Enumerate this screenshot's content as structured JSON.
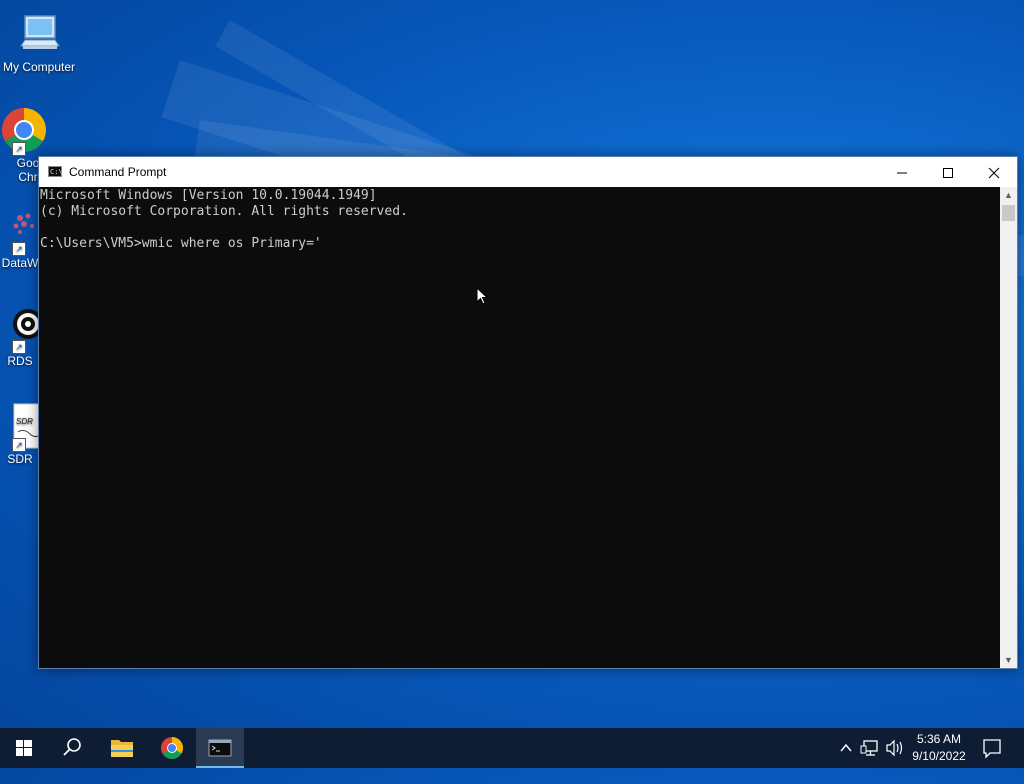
{
  "desktop": {
    "icons": [
      {
        "label": "My Computer",
        "icon": "computer-icon"
      },
      {
        "label": "Goo\nChr",
        "icon": "chrome-icon"
      },
      {
        "label": "DataW",
        "icon": "datawrapper-icon"
      },
      {
        "label": "RDS",
        "icon": "rds-icon"
      },
      {
        "label": "SDR",
        "icon": "sdr-icon"
      }
    ]
  },
  "window": {
    "title": "Command Prompt",
    "controls": {
      "minimize": "—",
      "maximize": "☐",
      "close": "✕"
    },
    "console_lines": [
      "Microsoft Windows [Version 10.0.19044.1949]",
      "(c) Microsoft Corporation. All rights reserved.",
      "",
      "C:\\Users\\VM5>wmic where os Primary='"
    ]
  },
  "taskbar": {
    "apps": [
      "start-icon",
      "search-icon",
      "file-explorer-icon",
      "chrome-icon",
      "command-prompt-icon"
    ],
    "active_app": "command-prompt-icon",
    "tray": {
      "chevron": "^",
      "time": "5:36 AM",
      "date": "9/10/2022"
    }
  },
  "colors": {
    "console_bg": "#0c0c0c",
    "console_fg": "#cccccc",
    "taskbar_bg": "#0e1d33",
    "accent": "#76b9ed"
  }
}
